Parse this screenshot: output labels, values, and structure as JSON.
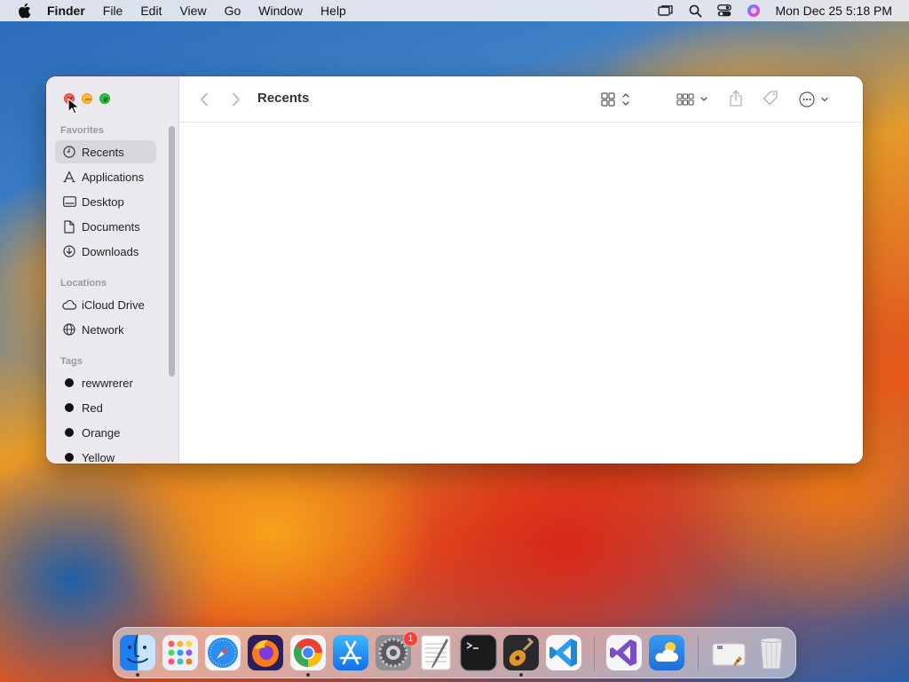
{
  "menubar": {
    "app_name": "Finder",
    "menus": [
      "File",
      "Edit",
      "View",
      "Go",
      "Window",
      "Help"
    ],
    "clock": "Mon Dec 25  5:18 PM",
    "icons": [
      "apple-icon",
      "screen-mirroring-icon",
      "spotlight-search-icon",
      "control-center-icon",
      "siri-icon"
    ]
  },
  "window": {
    "title": "Recents",
    "sidebar": {
      "favorites_title": "Favorites",
      "favorites": [
        {
          "label": "Recents",
          "icon": "clock-icon"
        },
        {
          "label": "Applications",
          "icon": "applications-icon"
        },
        {
          "label": "Desktop",
          "icon": "desktop-icon"
        },
        {
          "label": "Documents",
          "icon": "document-icon"
        },
        {
          "label": "Downloads",
          "icon": "download-icon"
        }
      ],
      "locations_title": "Locations",
      "locations": [
        {
          "label": "iCloud Drive",
          "icon": "cloud-icon"
        },
        {
          "label": "Network",
          "icon": "globe-icon"
        }
      ],
      "tags_title": "Tags",
      "tags": [
        {
          "label": "rewwrerer",
          "color": "#111111"
        },
        {
          "label": "Red",
          "color": "#111111"
        },
        {
          "label": "Orange",
          "color": "#111111"
        },
        {
          "label": "Yellow",
          "color": "#111111"
        }
      ]
    }
  },
  "dock": {
    "apps": [
      {
        "name": "Finder",
        "running": true,
        "icon": "finder-icon"
      },
      {
        "name": "Launchpad",
        "running": false,
        "icon": "launchpad-icon"
      },
      {
        "name": "Safari",
        "running": false,
        "icon": "safari-icon"
      },
      {
        "name": "Firefox",
        "running": false,
        "icon": "firefox-icon"
      },
      {
        "name": "Google Chrome",
        "running": true,
        "icon": "chrome-icon"
      },
      {
        "name": "App Store",
        "running": false,
        "icon": "app-store-icon"
      },
      {
        "name": "System Settings",
        "running": false,
        "icon": "settings-icon",
        "badge": "1"
      },
      {
        "name": "TextEdit",
        "running": false,
        "icon": "textedit-icon"
      },
      {
        "name": "Terminal",
        "running": false,
        "icon": "terminal-icon"
      },
      {
        "name": "GarageBand",
        "running": true,
        "icon": "garageband-icon"
      },
      {
        "name": "Visual Studio Code",
        "running": false,
        "icon": "vscode-icon"
      },
      {
        "name": "Visual Studio",
        "running": false,
        "icon": "visual-studio-icon"
      },
      {
        "name": "Weather",
        "running": false,
        "icon": "weather-icon"
      },
      {
        "name": "Downloads Stack",
        "running": false,
        "icon": "downloads-stack-icon"
      },
      {
        "name": "Trash",
        "running": false,
        "icon": "trash-icon"
      }
    ]
  }
}
